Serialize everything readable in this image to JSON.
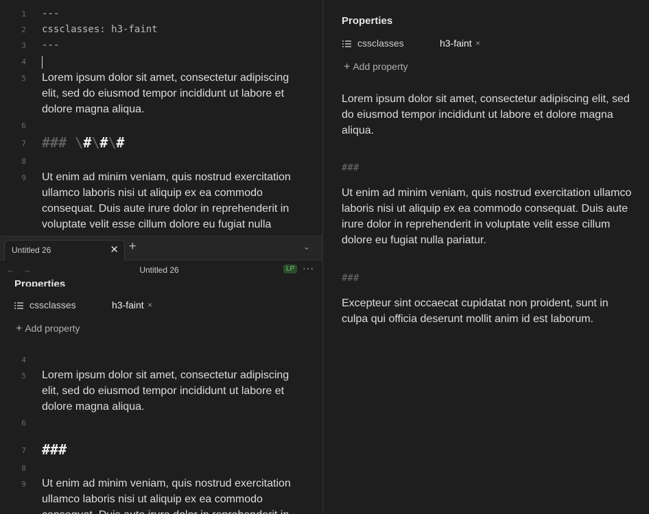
{
  "source_editor": {
    "lines": [
      {
        "n": "1",
        "text": "---"
      },
      {
        "n": "2",
        "text": "cssclasses: h3-faint"
      },
      {
        "n": "3",
        "text": "---"
      },
      {
        "n": "4",
        "text": ""
      },
      {
        "n": "5",
        "text": "Lorem ipsum dolor sit amet, consectetur adipiscing elit, sed do eiusmod tempor incididunt ut labore et dolore magna aliqua."
      },
      {
        "n": "6",
        "text": ""
      },
      {
        "n": "7",
        "text_faint": "### \\",
        "text_bright_a": "#",
        "text_faint_b": "\\",
        "text_bright_b": "#",
        "text_faint_c": "\\",
        "text_bright_c": "#"
      },
      {
        "n": "8",
        "text": ""
      },
      {
        "n": "9",
        "text": "Ut enim ad minim veniam, quis nostrud exercitation ullamco laboris nisi ut aliquip ex ea commodo consequat. Duis aute irure dolor in reprehenderit in voluptate velit esse cillum dolore eu fugiat nulla"
      }
    ]
  },
  "tabs": {
    "active_tab": "Untitled 26",
    "close_glyph": "✕",
    "new_tab_glyph": "+",
    "chevron_glyph": "⌄"
  },
  "view_header": {
    "back_glyph": "←",
    "forward_glyph": "→",
    "title": "Untitled 26",
    "mode_badge": "LP",
    "more_glyph": "···"
  },
  "properties": {
    "title": "Properties",
    "key": "cssclasses",
    "value": "h3-faint",
    "remove_glyph": "×",
    "add_label": "Add property",
    "add_glyph": "+"
  },
  "live_preview": {
    "lines": [
      {
        "n": "4",
        "text": ""
      },
      {
        "n": "5",
        "text": "Lorem ipsum dolor sit amet, consectetur adipiscing elit, sed do eiusmod tempor incididunt ut labore et dolore magna aliqua."
      },
      {
        "n": "6",
        "text": ""
      },
      {
        "n": "7",
        "text": "###"
      },
      {
        "n": "8",
        "text": ""
      },
      {
        "n": "9",
        "text": "Ut enim ad minim veniam, quis nostrud exercitation ullamco laboris nisi ut aliquip ex ea commodo consequat. Duis aute irure dolor in reprehenderit in"
      }
    ]
  },
  "reading_view": {
    "p1": "Lorem ipsum dolor sit amet, consectetur adipiscing elit, sed do eiusmod tempor incididunt ut labore et dolore magna aliqua.",
    "h3_a": "###",
    "p2": "Ut enim ad minim veniam, quis nostrud exercitation ullamco laboris nisi ut aliquip ex ea commodo consequat. Duis aute irure dolor in reprehenderit in voluptate velit esse cillum dolore eu fugiat nulla pariatur.",
    "h3_b": "###",
    "p3": "Excepteur sint occaecat cupidatat non proident, sunt in culpa qui officia deserunt mollit anim id est laborum."
  },
  "colors": {
    "background": "#1e1e1e",
    "text": "#dcddde",
    "faint_heading": "#6a6a6a",
    "badge_bg": "#2d4a2d",
    "badge_fg": "#6bbf6b"
  }
}
